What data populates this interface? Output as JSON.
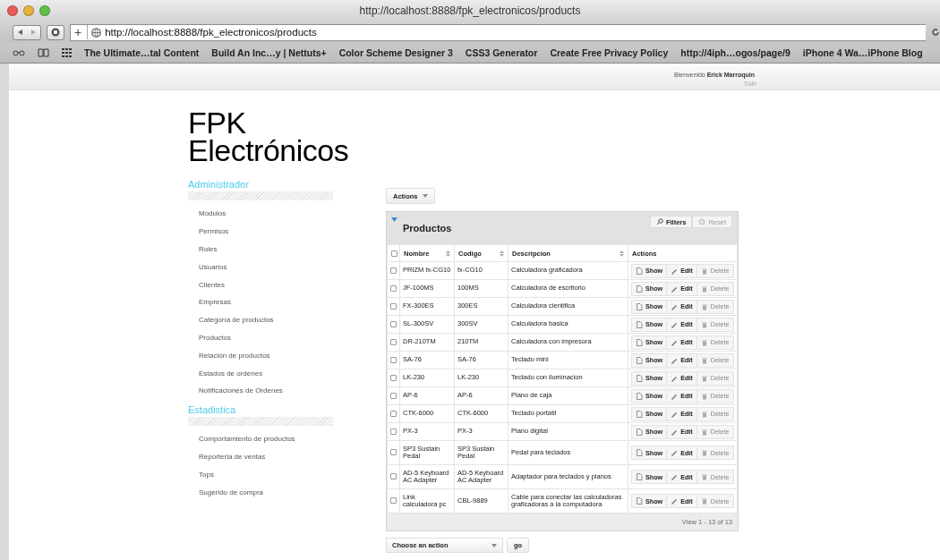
{
  "window": {
    "title": "http://localhost:8888/fpk_electronicos/products"
  },
  "address_bar": {
    "value": "http://localhost:8888/fpk_electronicos/products",
    "new_tab": "+"
  },
  "bookmarks": [
    "The Ultimate…tal Content",
    "Build An Inc…y | Nettuts+",
    "Color Scheme Designer 3",
    "CSS3 Generator",
    "Create Free Privacy Policy",
    "http://4iph…ogos/page/9",
    "iPhone 4 Wa…iPhone Blog"
  ],
  "user_bar": {
    "welcome": "Bienvenido **Erick Marroquin**",
    "logout": "Salir"
  },
  "logo": {
    "line_1": "FPK",
    "line_2": "Electrónicos"
  },
  "sidebar": [
    {
      "title": "Administrador",
      "items": [
        "Modulos",
        "Permisos",
        "Roles",
        "Usuarios",
        "Clientes",
        "Empresas",
        "Categoría de productos",
        "Productos",
        "Relación de productos",
        "Estados de ordenes",
        "Notificaciones de Ordenes"
      ]
    },
    {
      "title": "Estadistica",
      "items": [
        "Comportamiento de productos",
        "Reporteria de ventas",
        "Tops",
        "Sugerido de compra"
      ]
    }
  ],
  "actions_button": "Actions",
  "panel": {
    "title": "Productos",
    "filters": "Filters",
    "reset": "Reset",
    "expanded": true
  },
  "table": {
    "all_checked": false,
    "columns": [
      "Nombre",
      "Codigo",
      "Descripcion",
      "Actions"
    ],
    "rows": [
      {
        "checked": false,
        "nombre": "PRIZM fx-CG10",
        "codigo": "fx-CG10",
        "descripcion": "Calculadora graficadora",
        "actions": [
          "Show",
          "Edit",
          "Delete"
        ]
      },
      {
        "checked": false,
        "nombre": "JF-100MS",
        "codigo": "100MS",
        "descripcion": "Calculadora de escritorio",
        "actions": [
          "Show",
          "Edit",
          "Delete"
        ]
      },
      {
        "checked": false,
        "nombre": "FX-300ES",
        "codigo": "300ES",
        "descripcion": "Calculadora cientifica",
        "actions": [
          "Show",
          "Edit",
          "Delete"
        ]
      },
      {
        "checked": false,
        "nombre": "SL-300SV",
        "codigo": "300SV",
        "descripcion": "Calculadora basica",
        "actions": [
          "Show",
          "Edit",
          "Delete"
        ]
      },
      {
        "checked": false,
        "nombre": "DR-210TM",
        "codigo": "210TM",
        "descripcion": "Calculadora con impresora",
        "actions": [
          "Show",
          "Edit",
          "Delete"
        ]
      },
      {
        "checked": false,
        "nombre": "SA-76",
        "codigo": "SA-76",
        "descripcion": "Teclado mini",
        "actions": [
          "Show",
          "Edit",
          "Delete"
        ]
      },
      {
        "checked": false,
        "nombre": "LK-230",
        "codigo": "LK-230",
        "descripcion": "Teclado con iluminacion",
        "actions": [
          "Show",
          "Edit",
          "Delete"
        ]
      },
      {
        "checked": false,
        "nombre": "AP-6",
        "codigo": "AP-6",
        "descripcion": "Piano de caja",
        "actions": [
          "Show",
          "Edit",
          "Delete"
        ]
      },
      {
        "checked": false,
        "nombre": "CTK-6000",
        "codigo": "CTK-6000",
        "descripcion": "Teclado portatil",
        "actions": [
          "Show",
          "Edit",
          "Delete"
        ]
      },
      {
        "checked": false,
        "nombre": "PX-3",
        "codigo": "PX-3",
        "descripcion": "Piano digital",
        "actions": [
          "Show",
          "Edit",
          "Delete"
        ]
      },
      {
        "checked": false,
        "nombre": "SP3 Sustain Pedal",
        "codigo": "SP3 Sustain Pedal",
        "descripcion": "Pedal para teclados",
        "actions": [
          "Show",
          "Edit",
          "Delete"
        ]
      },
      {
        "checked": false,
        "nombre": "AD-5 Keyboard AC Adapter",
        "codigo": "AD-5 Keyboard AC Adapter",
        "descripcion": "Adaptador para teclados y pianos",
        "actions": [
          "Show",
          "Edit",
          "Delete"
        ]
      },
      {
        "checked": false,
        "nombre": "Link calculadora pc",
        "codigo": "CBL-9889",
        "descripcion": "Cable para conectar las calculadoras graficadoras a la computadora",
        "actions": [
          "Show",
          "Edit",
          "Delete"
        ]
      }
    ],
    "footer": "View 1 - 13 of 13"
  },
  "bulk": {
    "placeholder": "Choose an action",
    "go": "go"
  }
}
